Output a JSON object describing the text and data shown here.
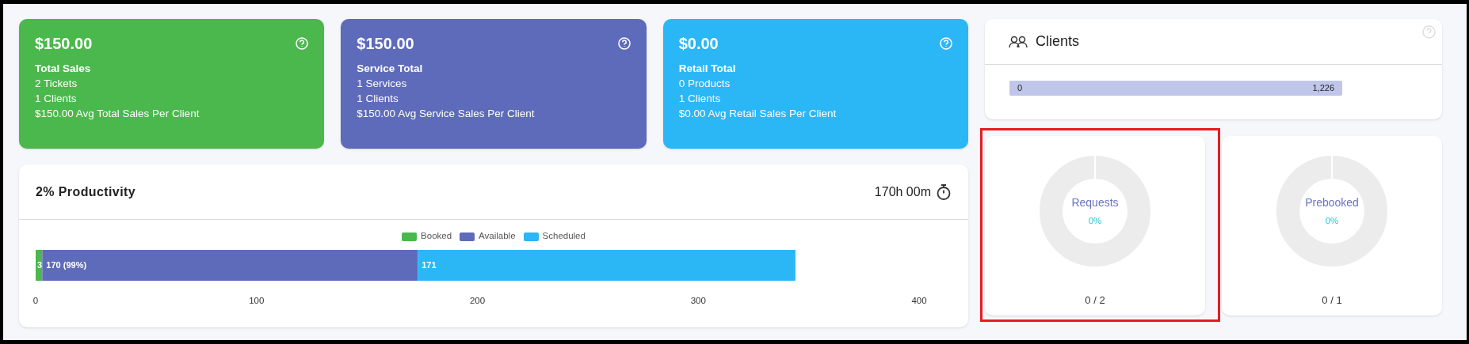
{
  "summary_cards": [
    {
      "amount": "$150.00",
      "title": "Total Sales",
      "lines": [
        "2 Tickets",
        "1 Clients",
        "$150.00 Avg Total Sales Per Client"
      ],
      "color": "#4ab84c"
    },
    {
      "amount": "$150.00",
      "title": "Service Total",
      "lines": [
        "1 Services",
        "1 Clients",
        "$150.00 Avg Service Sales Per Client"
      ],
      "color": "#5e6bba"
    },
    {
      "amount": "$0.00",
      "title": "Retail Total",
      "lines": [
        "0 Products",
        "1 Clients",
        "$0.00 Avg Retail Sales Per Client"
      ],
      "color": "#2bb6f6"
    }
  ],
  "productivity": {
    "title": "2% Productivity",
    "hours": "170h 00m",
    "chart_data": {
      "type": "bar",
      "orientation": "horizontal",
      "stacked": true,
      "legend": "top",
      "series": [
        {
          "name": "Booked",
          "color": "#4ab84c",
          "values": [
            3
          ]
        },
        {
          "name": "Available",
          "color": "#5e6bba",
          "values": [
            170
          ]
        },
        {
          "name": "Scheduled",
          "color": "#2bb6f6",
          "values": [
            171
          ]
        }
      ],
      "value_labels": [
        "3",
        "170 (99%)",
        "171"
      ],
      "xlim": [
        0,
        400
      ],
      "xticks": [
        0,
        100,
        200,
        300,
        400
      ]
    }
  },
  "clients": {
    "title": "Clients",
    "min_label": "0",
    "max_label": "1,226"
  },
  "donuts": [
    {
      "label": "Requests",
      "percent": "0%",
      "level": 0,
      "count": "0 / 2",
      "highlighted": true
    },
    {
      "label": "Prebooked",
      "percent": "0%",
      "level": 0,
      "count": "0 / 1",
      "highlighted": false
    }
  ]
}
